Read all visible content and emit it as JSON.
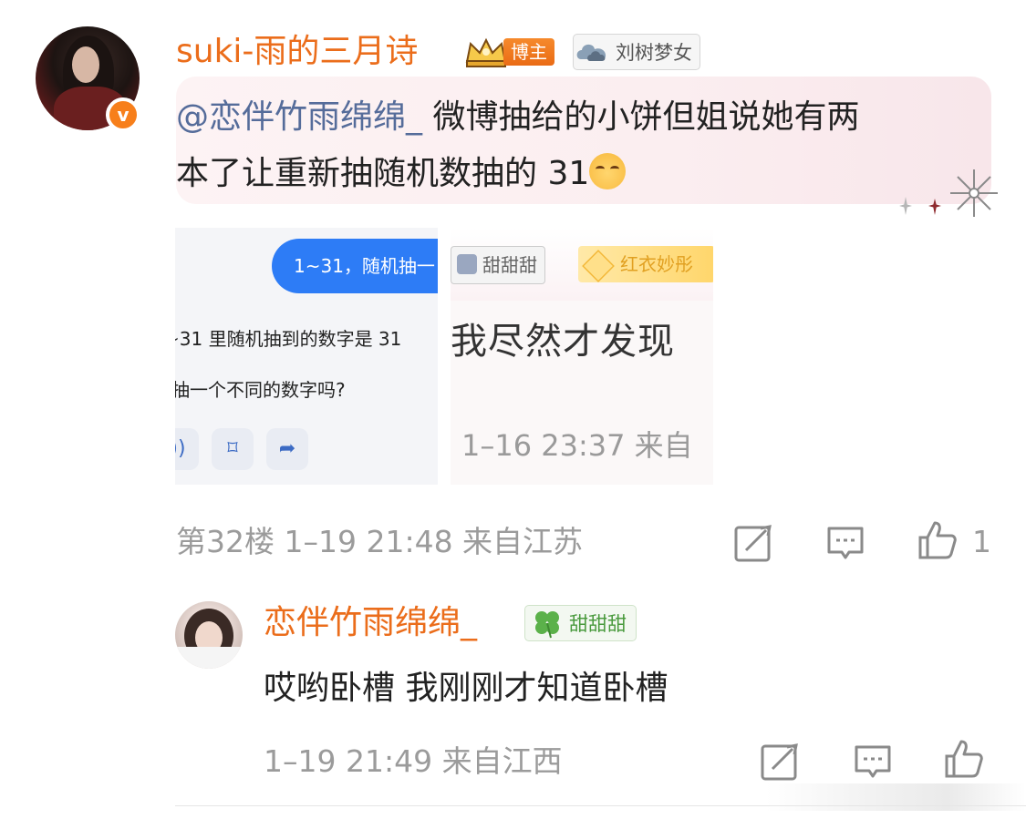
{
  "comment": {
    "username": "suki-雨的三月诗",
    "verified_mark": "v",
    "badge_label": "博主",
    "fan_tag": "刘树梦女",
    "mention": "@恋伴竹雨绵绵_",
    "text_line1_rest": " 微博抽给的小饼但姐说她有两",
    "text_line2": "本了让重新抽随机数抽的 31",
    "floor_info": "第32楼  1–19  21:48  来自江苏",
    "like_count": "1",
    "images": {
      "img1": {
        "bubble": "1~31，随机抽一",
        "line1": "~31 里随机抽到的数字是 31",
        "line2": "抽一个不同的数字吗?"
      },
      "img2": {
        "tag1": "甜甜甜",
        "tag2": "红衣妙彤",
        "main": "我尽然才发现",
        "time": "1–16  23:37  来自"
      }
    }
  },
  "reply": {
    "username": "恋伴竹雨绵绵_",
    "tag": "甜甜甜",
    "text": "哎哟卧槽 我刚刚才知道卧槽",
    "meta": "1–19  21:49  来自江西"
  },
  "colors": {
    "username": "#eb6d1b",
    "mention": "#556c9a",
    "meta": "#9b9b9b",
    "badge_orange": "#f77f1b"
  }
}
